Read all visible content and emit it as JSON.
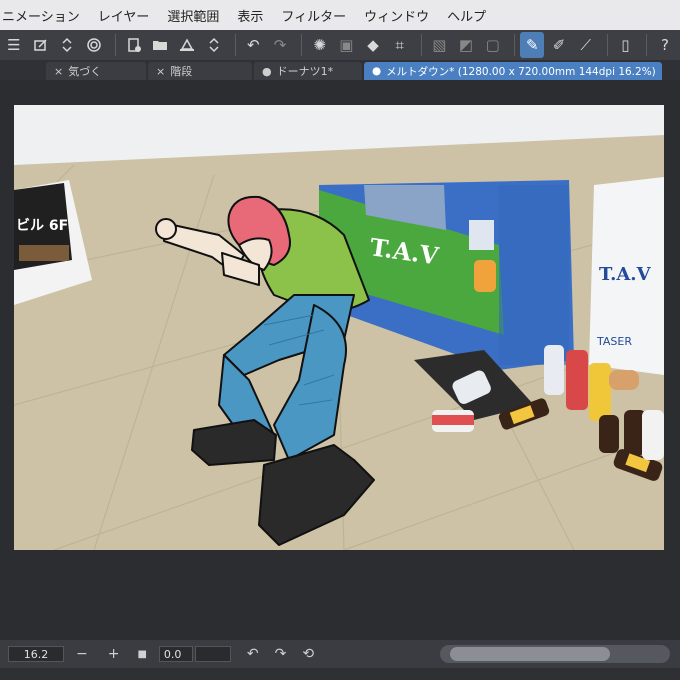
{
  "menu": {
    "items": [
      "ニメーション",
      "レイヤー",
      "選択範囲",
      "表示",
      "フィルター",
      "ウィンドウ",
      "ヘルプ"
    ]
  },
  "toolbar": {
    "icons": [
      "menu-icon",
      "layer-icon",
      "updown-icon",
      "swirl-icon",
      "new-file-icon",
      "open-folder-icon",
      "scanner-icon",
      "updown-icon",
      "undo-icon",
      "redo-icon",
      "loading-icon",
      "transform-icon",
      "fill-icon",
      "crop-icon",
      "snap-grid-icon",
      "gradient-icon",
      "frame-icon",
      "pen-icon",
      "brush-icon",
      "ruler-pen-icon",
      "tablet-icon",
      "help-icon"
    ],
    "active_index": 17
  },
  "tabs": [
    {
      "label": "気づく",
      "marker": "×",
      "active": false
    },
    {
      "label": "階段",
      "marker": "×",
      "active": false
    },
    {
      "label": "ドーナツ1*",
      "marker": "●",
      "active": false
    },
    {
      "label": "メルトダウン* (1280.00 x 720.00mm 144dpi 16.2%)",
      "marker": "●",
      "active": true
    }
  ],
  "status": {
    "zoom": "16.2",
    "rotation": "0.0",
    "minus": "−",
    "plus": "+"
  },
  "artwork": {
    "sign_text": "ビル 6F",
    "machine_brand": "T.A.V",
    "bin_brand": "T.A.V",
    "bin_text": "TASER",
    "colors": {
      "floor": "#cfc4a8",
      "wall": "#f0f2f4",
      "machine_blue": "#3a6fc8",
      "machine_green": "#4aa83e",
      "hair": "#e86a78",
      "shirt": "#8cc24a",
      "jeans": "#4a97c4",
      "shoes": "#2a2a2a"
    }
  }
}
